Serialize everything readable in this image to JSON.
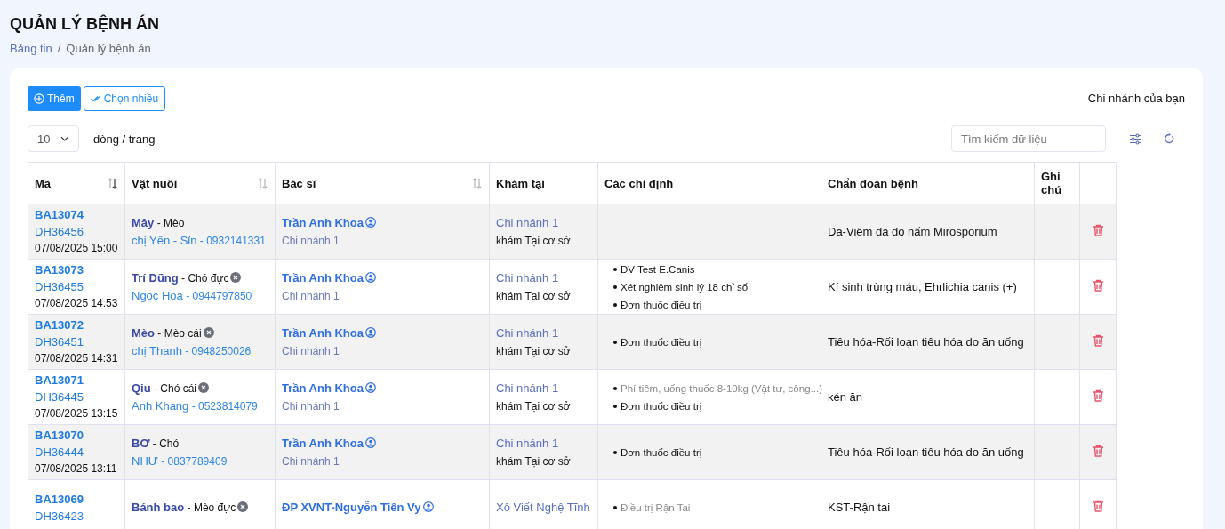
{
  "page": {
    "title": "QUẢN LÝ BỆNH ÁN",
    "breadcrumb": [
      {
        "label": "Bảng tin",
        "kind": "link"
      },
      {
        "label": "/",
        "kind": "separator"
      },
      {
        "label": "Quản lý bệnh án",
        "kind": "current"
      }
    ]
  },
  "toolbar": {
    "add_button": "Thêm",
    "multi_select_button": "Chọn nhiều",
    "branch_label": "Chi nhánh của bạn",
    "page_size": "10",
    "page_size_label": "dòng / trang",
    "search": {
      "placeholder": "Tìm kiếm dữ liệu"
    }
  },
  "table": {
    "columns": [
      {
        "label": "Mã",
        "sort_active": true
      },
      {
        "label": "Vật nuôi",
        "sort_active": false
      },
      {
        "label": "Bác sĩ",
        "sort_active": false
      },
      {
        "label": "Khám tại"
      },
      {
        "label": "Các chỉ định"
      },
      {
        "label": "Chẩn đoán bệnh"
      },
      {
        "label": "Ghi chú"
      },
      {}
    ],
    "rows": [
      {
        "code": "BA13074",
        "order": "DH36456",
        "time": "07/08/2025 15:00",
        "pet": "Mây",
        "species": "- Mèo",
        "marked": false,
        "owner": "chị Yến - Sỉn",
        "phone": "- 0932141331",
        "doctor": "Trần Anh Khoa",
        "doctor_branch": "Chi nhánh 1",
        "place": "Chi nhánh 1",
        "visit": "khám Tại cơ sở",
        "orders": [],
        "diagnosis": "Da-Viêm da do nấm Mirosporium"
      },
      {
        "code": "BA13073",
        "order": "DH36455",
        "time": "07/08/2025 14:53",
        "pet": "Trí Dũng",
        "species": "- Chó đực",
        "marked": true,
        "owner": "Ngọc Hoa",
        "phone": "- 0944797850",
        "doctor": "Trần Anh Khoa",
        "doctor_branch": "Chi nhánh 1",
        "place": "Chi nhánh 1",
        "visit": "khám Tại cơ sở",
        "orders": [
          {
            "text": "DV Test E.Canis",
            "muted": false
          },
          {
            "text": "Xét nghiệm sinh lý 18 chỉ số",
            "muted": false
          },
          {
            "text": "Đơn thuốc điều trị",
            "muted": false
          }
        ],
        "diagnosis": "Kí sinh trùng máu, Ehrlichia canis (+)"
      },
      {
        "code": "BA13072",
        "order": "DH36451",
        "time": "07/08/2025 14:31",
        "pet": "Mèo",
        "species": "- Mèo cái",
        "marked": true,
        "owner": "chị Thanh",
        "phone": "- 0948250026",
        "doctor": "Trần Anh Khoa",
        "doctor_branch": "Chi nhánh 1",
        "place": "Chi nhánh 1",
        "visit": "khám Tại cơ sở",
        "orders": [
          {
            "text": "Đơn thuốc điều trị",
            "muted": false
          }
        ],
        "diagnosis": "Tiêu hóa-Rối loạn tiêu hóa do ăn uống"
      },
      {
        "code": "BA13071",
        "order": "DH36445",
        "time": "07/08/2025 13:15",
        "pet": "Qiu",
        "species": "- Chó cái",
        "marked": true,
        "owner": "Anh Khang",
        "phone": "- 0523814079",
        "doctor": "Trần Anh Khoa",
        "doctor_branch": "Chi nhánh 1",
        "place": "Chi nhánh 1",
        "visit": "khám Tại cơ sở",
        "orders": [
          {
            "text": "Phí tiêm, uống thuốc 8-10kg (Vật tư, công...)",
            "muted": true
          },
          {
            "text": "Đơn thuốc điều trị",
            "muted": false
          }
        ],
        "diagnosis": "kén ăn"
      },
      {
        "code": "BA13070",
        "order": "DH36444",
        "time": "07/08/2025 13:11",
        "pet": "BƠ",
        "species": "- Chó",
        "marked": false,
        "owner": "NHƯ",
        "phone": "- 0837789409",
        "doctor": "Trần Anh Khoa",
        "doctor_branch": "Chi nhánh 1",
        "place": "Chi nhánh 1",
        "visit": "khám Tại cơ sở",
        "orders": [
          {
            "text": "Đơn thuốc điều trị",
            "muted": false
          }
        ],
        "diagnosis": "Tiêu hóa-Rối loạn tiêu hóa do ăn uống"
      },
      {
        "code": "BA13069",
        "order": "DH36423",
        "pet": "Bánh bao",
        "species": "- Mèo đực",
        "marked": true,
        "doctor": "ĐP XVNT-Nguyễn Tiên Vy",
        "place": "Xô Viết Nghệ Tĩnh",
        "orders": [
          {
            "text": "Điều trị Rận Tai",
            "muted": true
          }
        ],
        "diagnosis": "KST-Rận tai"
      }
    ]
  }
}
